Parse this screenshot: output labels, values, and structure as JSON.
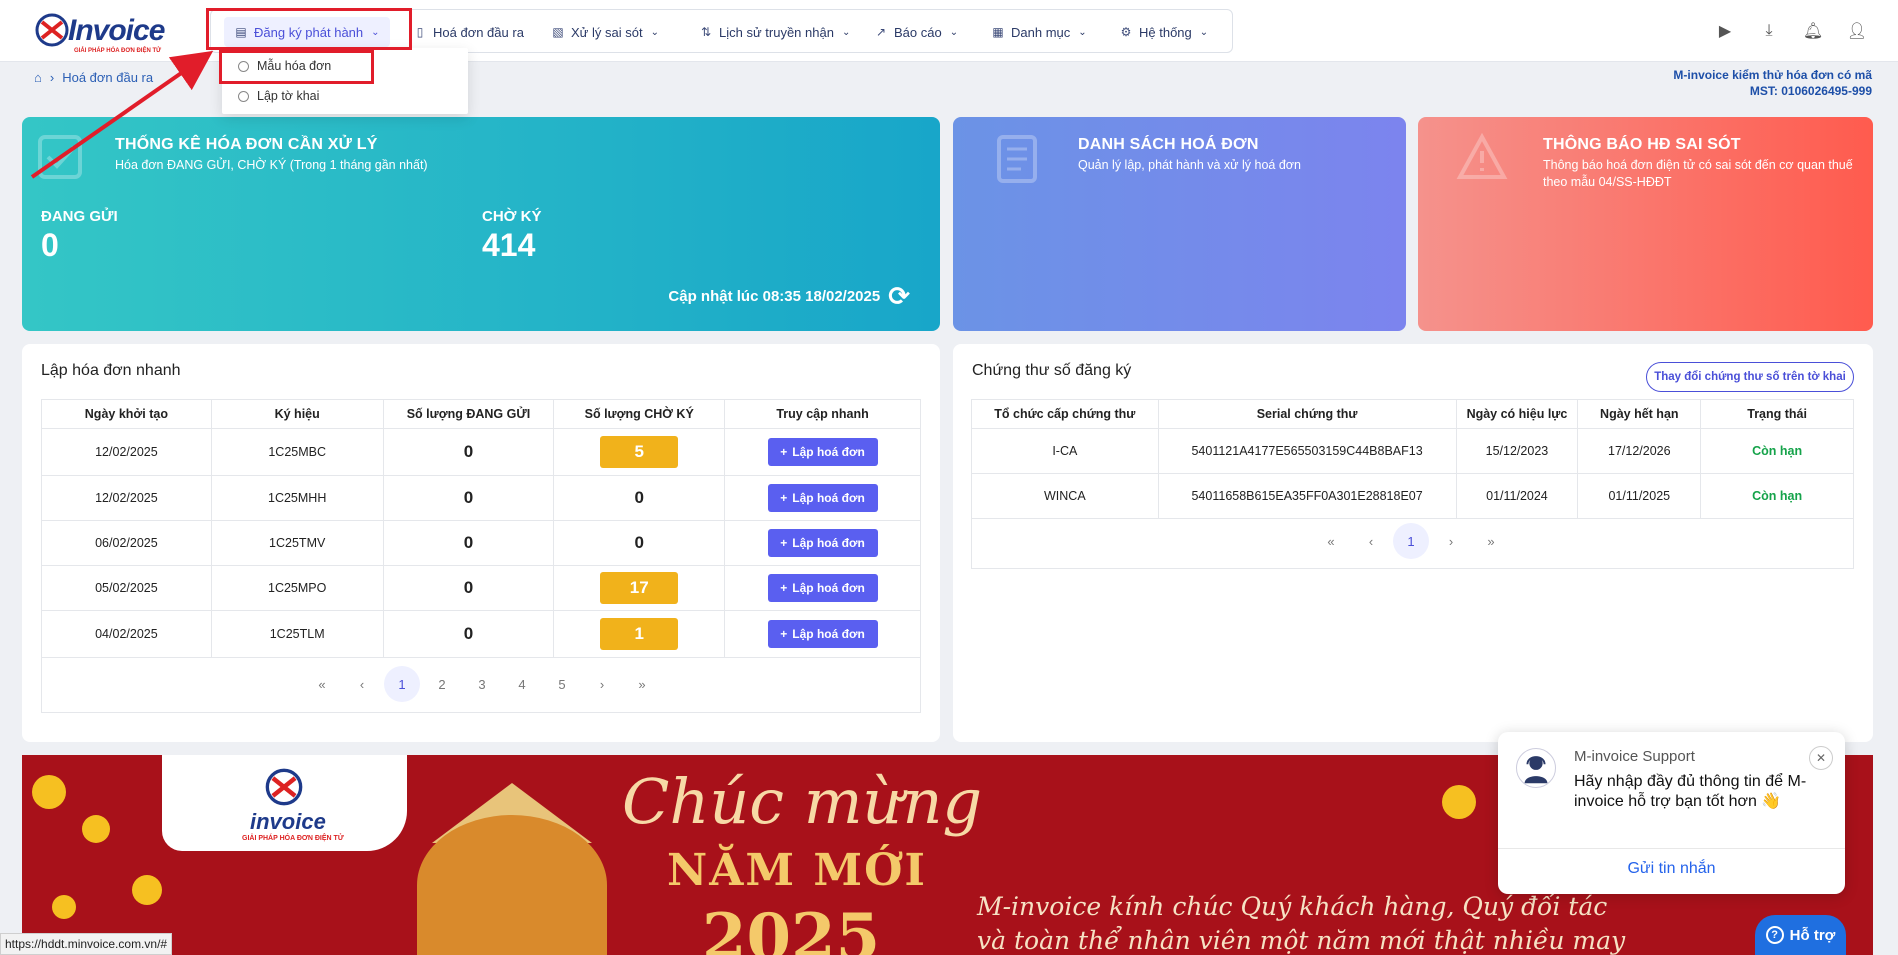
{
  "brand": {
    "name": "Invoice",
    "tagline": "GIẢI PHÁP HÓA ĐƠN ĐIỆN TỬ"
  },
  "nav": [
    {
      "label": "Đăng ký phát hành",
      "icon": "document-gear-icon",
      "active": true
    },
    {
      "label": "Hoá đơn đầu ra",
      "icon": "file-icon"
    },
    {
      "label": "Xử lý sai sót",
      "icon": "file-edit-icon"
    },
    {
      "label": "Lịch sử truyền nhận",
      "icon": "arrows-updown-icon"
    },
    {
      "label": "Báo cáo",
      "icon": "chart-icon"
    },
    {
      "label": "Danh mục",
      "icon": "grid-icon"
    },
    {
      "label": "Hệ thống",
      "icon": "gear-icon"
    }
  ],
  "dropdown": [
    {
      "label": "Mẫu hóa đơn"
    },
    {
      "label": "Lập tờ khai"
    }
  ],
  "breadcrumb": {
    "current": "Hoá đơn đầu ra"
  },
  "company": {
    "name": "M-invoice kiểm thử hóa đơn có mã",
    "mst": "MST: 0106026495-999"
  },
  "cards": {
    "stats": {
      "title": "THỐNG KÊ HÓA ĐƠN CẦN XỬ LÝ",
      "subtitle": "Hóa đơn ĐANG GỬI, CHỜ KÝ (Trong 1 tháng gần nhất)",
      "sending_label": "ĐANG GỬI",
      "sending_value": "0",
      "waiting_label": "CHỜ KÝ",
      "waiting_value": "414",
      "updated": "Cập nhật lúc 08:35 18/02/2025"
    },
    "list": {
      "title": "DANH SÁCH HOÁ ĐƠN",
      "subtitle": "Quản lý lập, phát hành và xử lý hoá đơn"
    },
    "errors": {
      "title": "THÔNG BÁO HĐ SAI SÓT",
      "subtitle": "Thông báo hoá đơn điện tử có sai sót đến cơ quan thuế theo mẫu 04/SS-HĐĐT"
    }
  },
  "quick": {
    "title": "Lập hóa đơn nhanh",
    "headers": [
      "Ngày khởi tạo",
      "Ký hiệu",
      "Số lượng ĐANG GỬI",
      "Số lượng CHỜ KÝ",
      "Truy cập nhanh"
    ],
    "button_label": "Lập hoá đơn",
    "rows": [
      {
        "date": "12/02/2025",
        "code": "1C25MBC",
        "sending": "0",
        "waiting": "5",
        "waiting_pill": true
      },
      {
        "date": "12/02/2025",
        "code": "1C25MHH",
        "sending": "0",
        "waiting": "0",
        "waiting_pill": false
      },
      {
        "date": "06/02/2025",
        "code": "1C25TMV",
        "sending": "0",
        "waiting": "0",
        "waiting_pill": false
      },
      {
        "date": "05/02/2025",
        "code": "1C25MPO",
        "sending": "0",
        "waiting": "17",
        "waiting_pill": true
      },
      {
        "date": "04/02/2025",
        "code": "1C25TLM",
        "sending": "0",
        "waiting": "1",
        "waiting_pill": true
      }
    ],
    "pages": [
      "«",
      "‹",
      "1",
      "2",
      "3",
      "4",
      "5",
      "›",
      "»"
    ],
    "current_page": "1"
  },
  "certs": {
    "title": "Chứng thư số đăng ký",
    "change_button": "Thay đổi chứng thư số trên tờ khai",
    "headers": [
      "Tổ chức cấp chứng thư",
      "Serial chứng thư",
      "Ngày có hiệu lực",
      "Ngày hết hạn",
      "Trạng thái"
    ],
    "rows": [
      {
        "org": "I-CA",
        "serial": "5401121A4177E565503159C44B8BAF13",
        "from": "15/12/2023",
        "to": "17/12/2026",
        "status": "Còn hạn"
      },
      {
        "org": "WINCA",
        "serial": "54011658B615EA35FF0A301E28818E07",
        "from": "01/11/2024",
        "to": "01/11/2025",
        "status": "Còn hạn"
      }
    ],
    "pages": [
      "«",
      "‹",
      "1",
      "›",
      "»"
    ],
    "current_page": "1"
  },
  "banner": {
    "brand": "invoice",
    "brand_tag": "GIẢI PHÁP HÓA ĐƠN ĐIỆN TỬ",
    "greeting": "Chúc mừng",
    "headline": "NĂM MỚI",
    "year": "2025",
    "wish": "M-invoice kính chúc Quý khách hàng, Quý đối tác và toàn thể nhân viên một năm mới thật nhiều may mắn,"
  },
  "support": {
    "name": "M-invoice Support",
    "message": "Hãy nhập đầy đủ thông tin để M-invoice hỗ trợ bạn tốt hơn 👋",
    "send": "Gửi tin nhắn"
  },
  "help_label": "Hỗ trợ",
  "status_url": "https://hddt.minvoice.com.vn/#",
  "colors": {
    "accent": "#4a4fd8",
    "highlight": "#e11d2a",
    "pill": "#f1b21b",
    "ok": "#15a34a"
  }
}
